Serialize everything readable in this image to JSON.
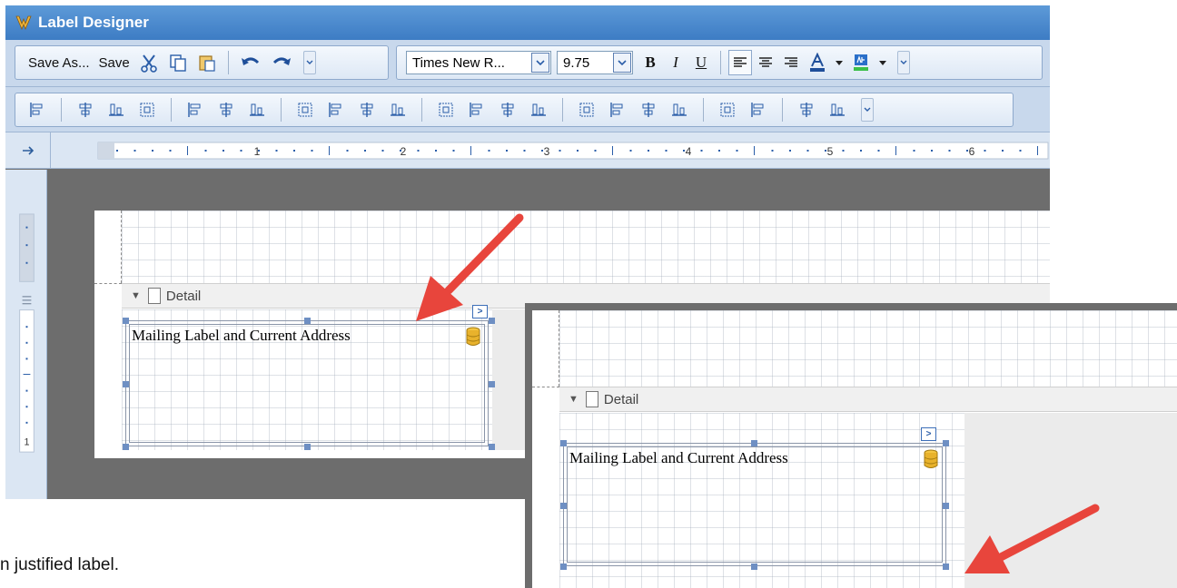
{
  "window": {
    "title": "Label Designer"
  },
  "toolbar": {
    "save_as_label": "Save As...",
    "save_label": "Save",
    "font_name": "Times New R...",
    "font_size": "9.75",
    "bold_label": "B",
    "italic_label": "I",
    "underline_label": "U"
  },
  "ruler": {
    "marks": [
      "1",
      "2",
      "3",
      "4",
      "5",
      "6"
    ],
    "vertical_mark": "1"
  },
  "report": {
    "band_label": "Detail",
    "label_text": "Mailing Label and Current Address"
  },
  "caption": "n justified label.",
  "colors": {
    "titlebar": "#4a88cc",
    "toolbar": "#c8d8ec",
    "canvas": "#6d6d6d",
    "arrow": "#e8453c",
    "handle": "#6e8fc3"
  },
  "icons": [
    "app-icon",
    "cut-icon",
    "copy-icon",
    "paste-icon",
    "undo-icon",
    "redo-icon",
    "font-color-icon",
    "highlight-icon",
    "align-left-icon",
    "align-center-icon",
    "align-right-icon",
    "database-icon"
  ]
}
